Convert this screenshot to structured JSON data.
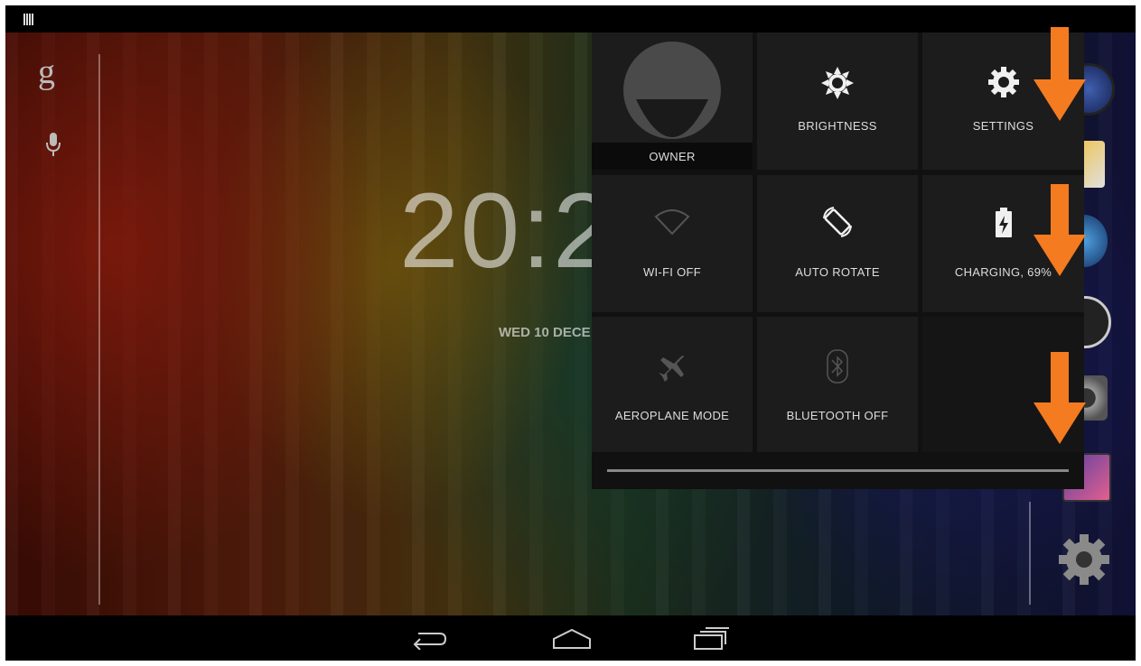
{
  "status_bar": {
    "notification_icon": "barcode-notification-icon"
  },
  "home": {
    "search_icon": "google-search-icon",
    "voice_icon": "mic-icon",
    "clock": "20:2",
    "date": "WED 10 DECE"
  },
  "quick_settings": {
    "owner": {
      "label": "OWNER",
      "icon": "user-avatar-icon"
    },
    "brightness": {
      "label": "BRIGHTNESS",
      "icon": "brightness-icon"
    },
    "settings": {
      "label": "SETTINGS",
      "icon": "gear-icon"
    },
    "wifi": {
      "label": "WI-FI OFF",
      "icon": "wifi-icon"
    },
    "auto_rotate": {
      "label": "AUTO ROTATE",
      "icon": "rotate-icon"
    },
    "battery": {
      "label": "CHARGING, 69%",
      "icon": "battery-charging-icon"
    },
    "aeroplane": {
      "label": "AEROPLANE MODE",
      "icon": "airplane-icon"
    },
    "bluetooth": {
      "label": "BLUETOOTH OFF",
      "icon": "bluetooth-icon"
    }
  },
  "nav": {
    "back": "back-icon",
    "home": "home-icon",
    "recents": "recents-icon"
  },
  "colors": {
    "accent_arrow": "#f47b20",
    "panel": "#111111",
    "tile": "#1c1c1c"
  }
}
